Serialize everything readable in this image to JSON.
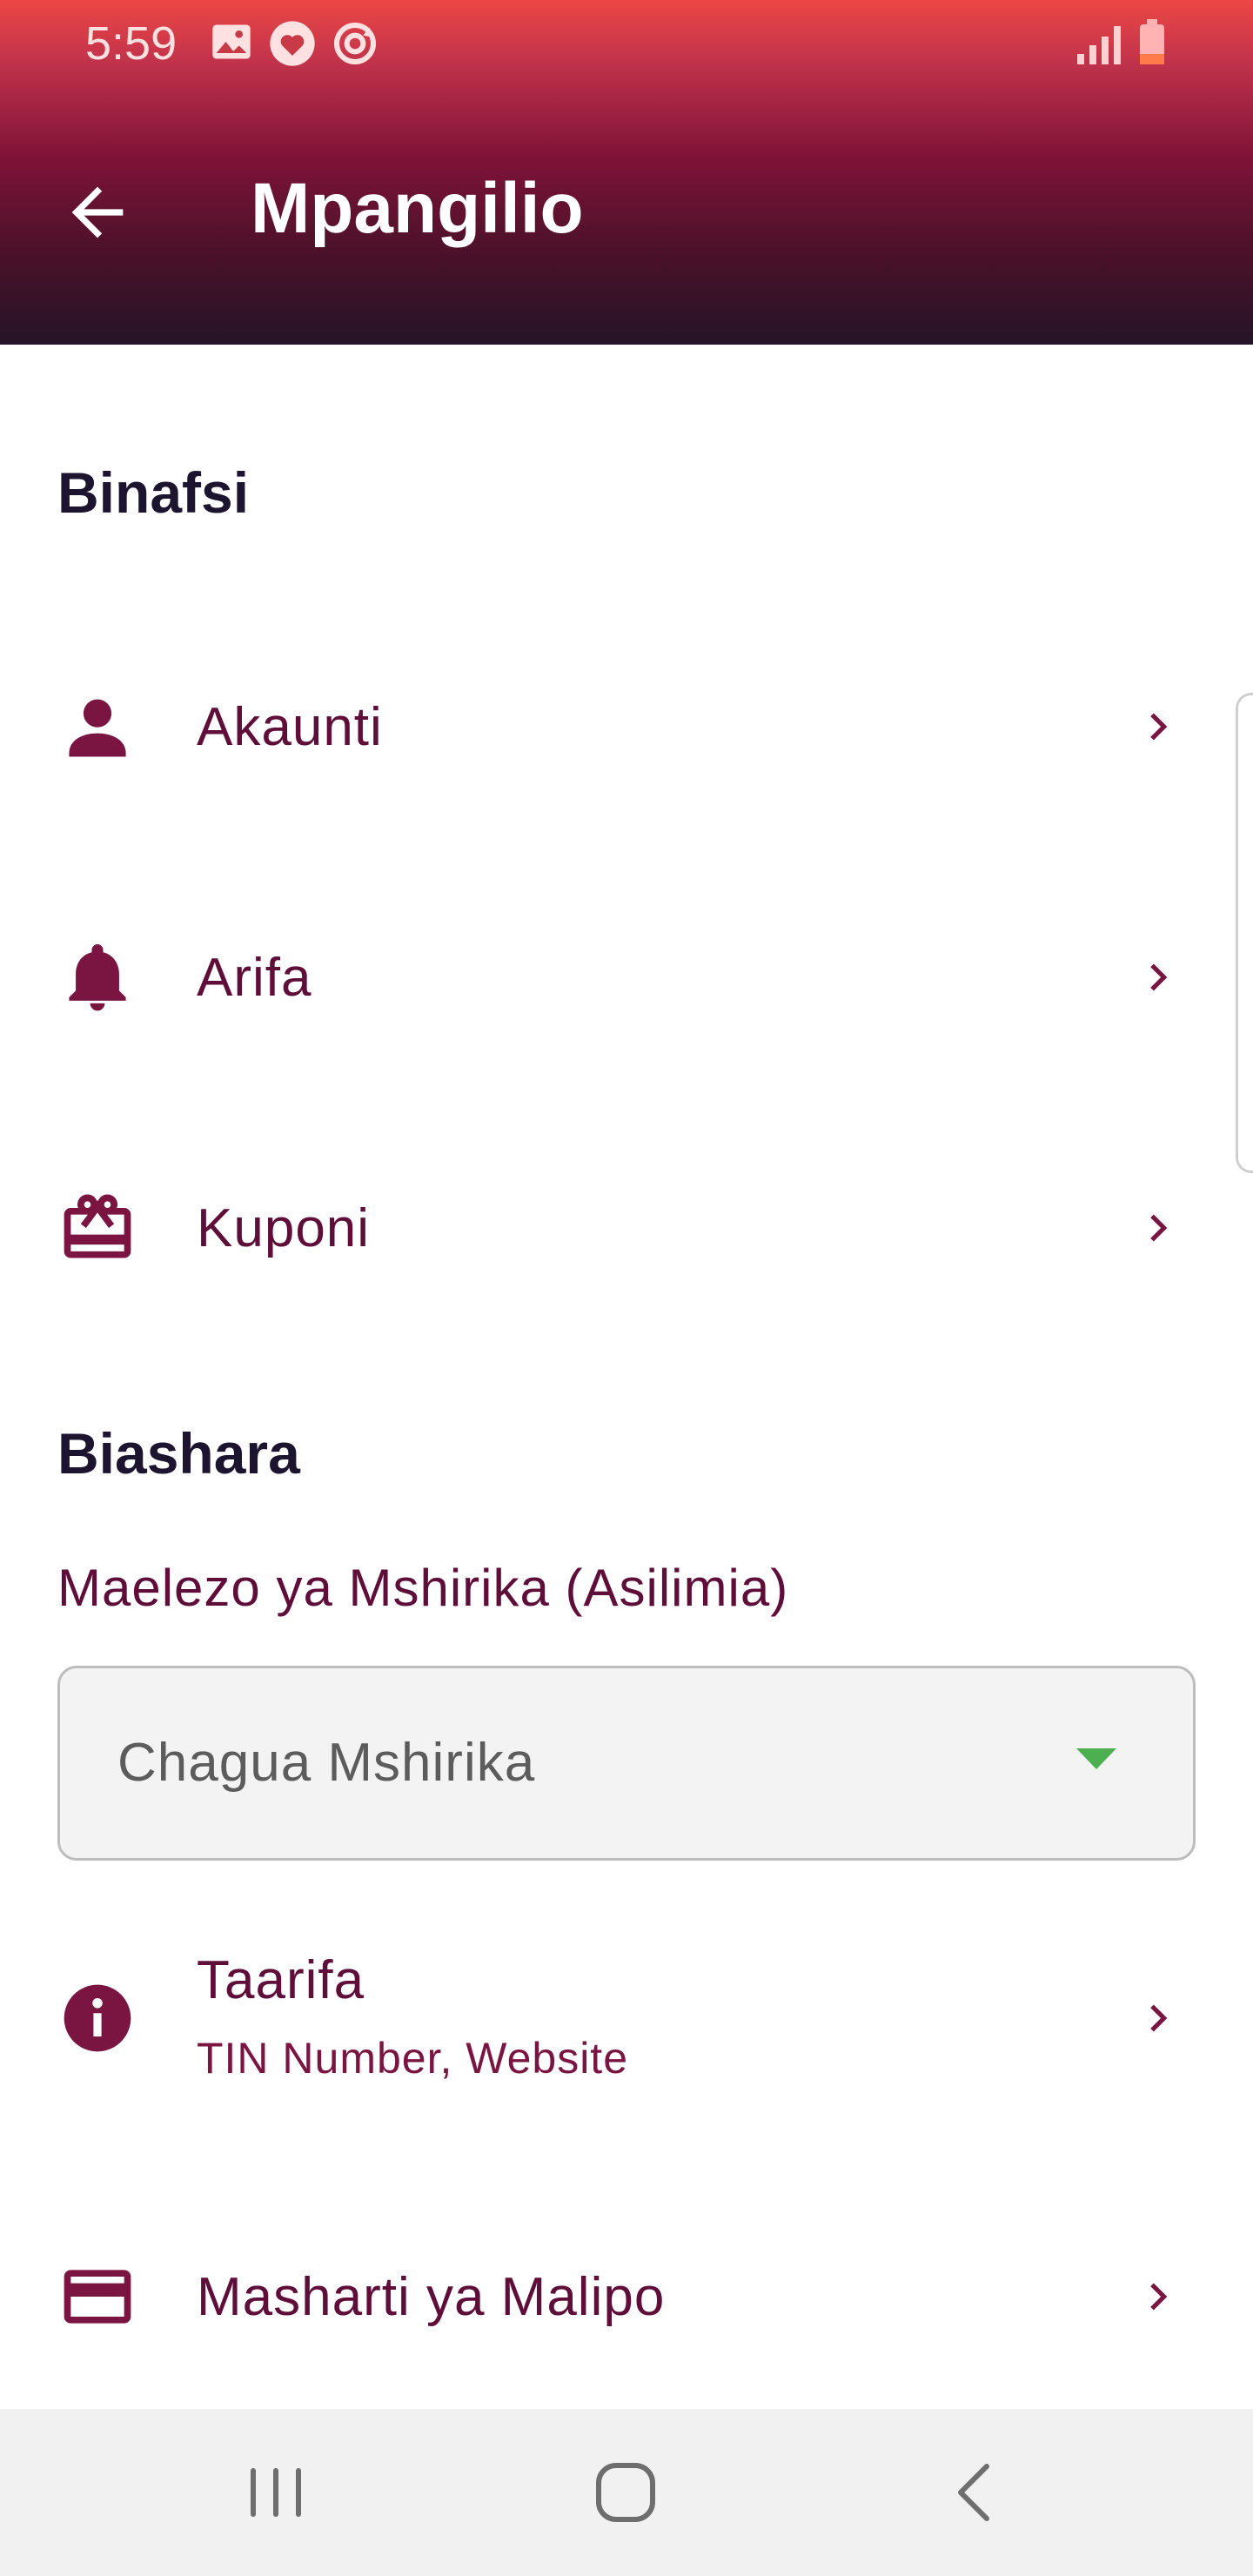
{
  "status_bar": {
    "time": "5:59",
    "icons": [
      "gallery-icon",
      "heart-badge-icon",
      "sync-icon"
    ],
    "right_icons": [
      "signal-icon",
      "battery-icon"
    ]
  },
  "app_bar": {
    "title": "Mpangilio",
    "back_icon": "arrow-left-icon"
  },
  "sections": {
    "personal": {
      "title": "Binafsi",
      "items": [
        {
          "label": "Akaunti",
          "icon": "person-icon"
        },
        {
          "label": "Arifa",
          "icon": "bell-icon"
        },
        {
          "label": "Kuponi",
          "icon": "gift-card-icon"
        }
      ]
    },
    "business": {
      "title": "Biashara",
      "partner_label": "Maelezo ya Mshirika (Asilimia)",
      "partner_dropdown": {
        "selected": "Chagua Mshirika",
        "arrow_icon": "caret-down-icon"
      },
      "items": [
        {
          "label": "Taarifa",
          "subtitle": "TIN Number, Website",
          "icon": "info-icon"
        },
        {
          "label": "Masharti ya Malipo",
          "icon": "credit-card-icon"
        }
      ]
    }
  },
  "nav_bar": {
    "buttons": [
      "recent-apps-icon",
      "home-icon",
      "back-icon"
    ]
  },
  "colors": {
    "accent": "#7a1440",
    "header_top": "#ec4745",
    "header_bottom": "#241427",
    "dropdown_arrow": "#4caf50"
  }
}
